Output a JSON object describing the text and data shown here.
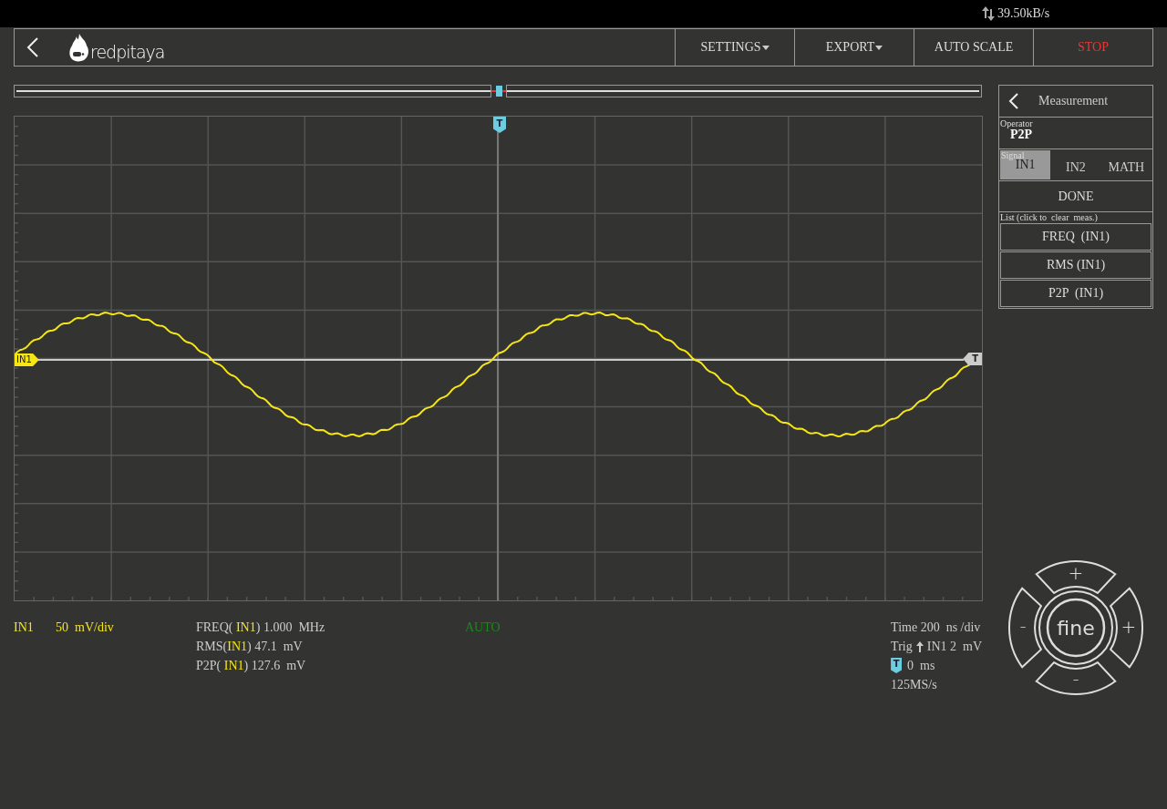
{
  "status_bar": {
    "transfer_rate": "39.50kB/s"
  },
  "header": {
    "logo_text": "redpitaya",
    "menus": [
      {
        "label": "SETTINGS",
        "kind": "dropdown"
      },
      {
        "label": "EXPORT",
        "kind": "dropdown"
      },
      {
        "label": "AUTO SCALE",
        "kind": "button"
      },
      {
        "label": "STOP",
        "kind": "stop"
      }
    ]
  },
  "buffer_slider": {
    "level": 0.5
  },
  "plot": {
    "trigger_marker": "T",
    "channel_marker": "IN1",
    "level_marker": "T"
  },
  "info": {
    "channel": "IN1",
    "scale": "50  mV/div",
    "measurements": [
      {
        "prefix": "FREQ( ",
        "channel": "IN1",
        "suffix": ") 1.000  MHz"
      },
      {
        "prefix": "RMS(",
        "channel": "IN1",
        "suffix": ") 47.1  mV"
      },
      {
        "prefix": "P2P( ",
        "channel": "IN1",
        "suffix": ") 127.6  mV"
      }
    ],
    "mode": "AUTO",
    "time": "Time 200  ns /div",
    "trig_label": "Trig",
    "trig_value": "IN1 2  mV",
    "offset_marker": "T",
    "offset": "0  ms",
    "sample_rate": "125MS/s"
  },
  "panel": {
    "title": "Measurement",
    "operator_label": "Operator",
    "operator": "P2P",
    "signal_label": "Signal",
    "signals": [
      {
        "label": "IN1",
        "selected": true
      },
      {
        "label": "IN2",
        "selected": false
      },
      {
        "label": "MATH",
        "selected": false
      }
    ],
    "done": "DONE",
    "list_label": "List (click to  clear  meas.)",
    "list": [
      "FREQ  (IN1)",
      "RMS (IN1)",
      "P2P  (IN1)"
    ]
  },
  "knob": {
    "top": "+",
    "left": "-",
    "right": "+",
    "bottom": "-",
    "center": "fine"
  }
}
